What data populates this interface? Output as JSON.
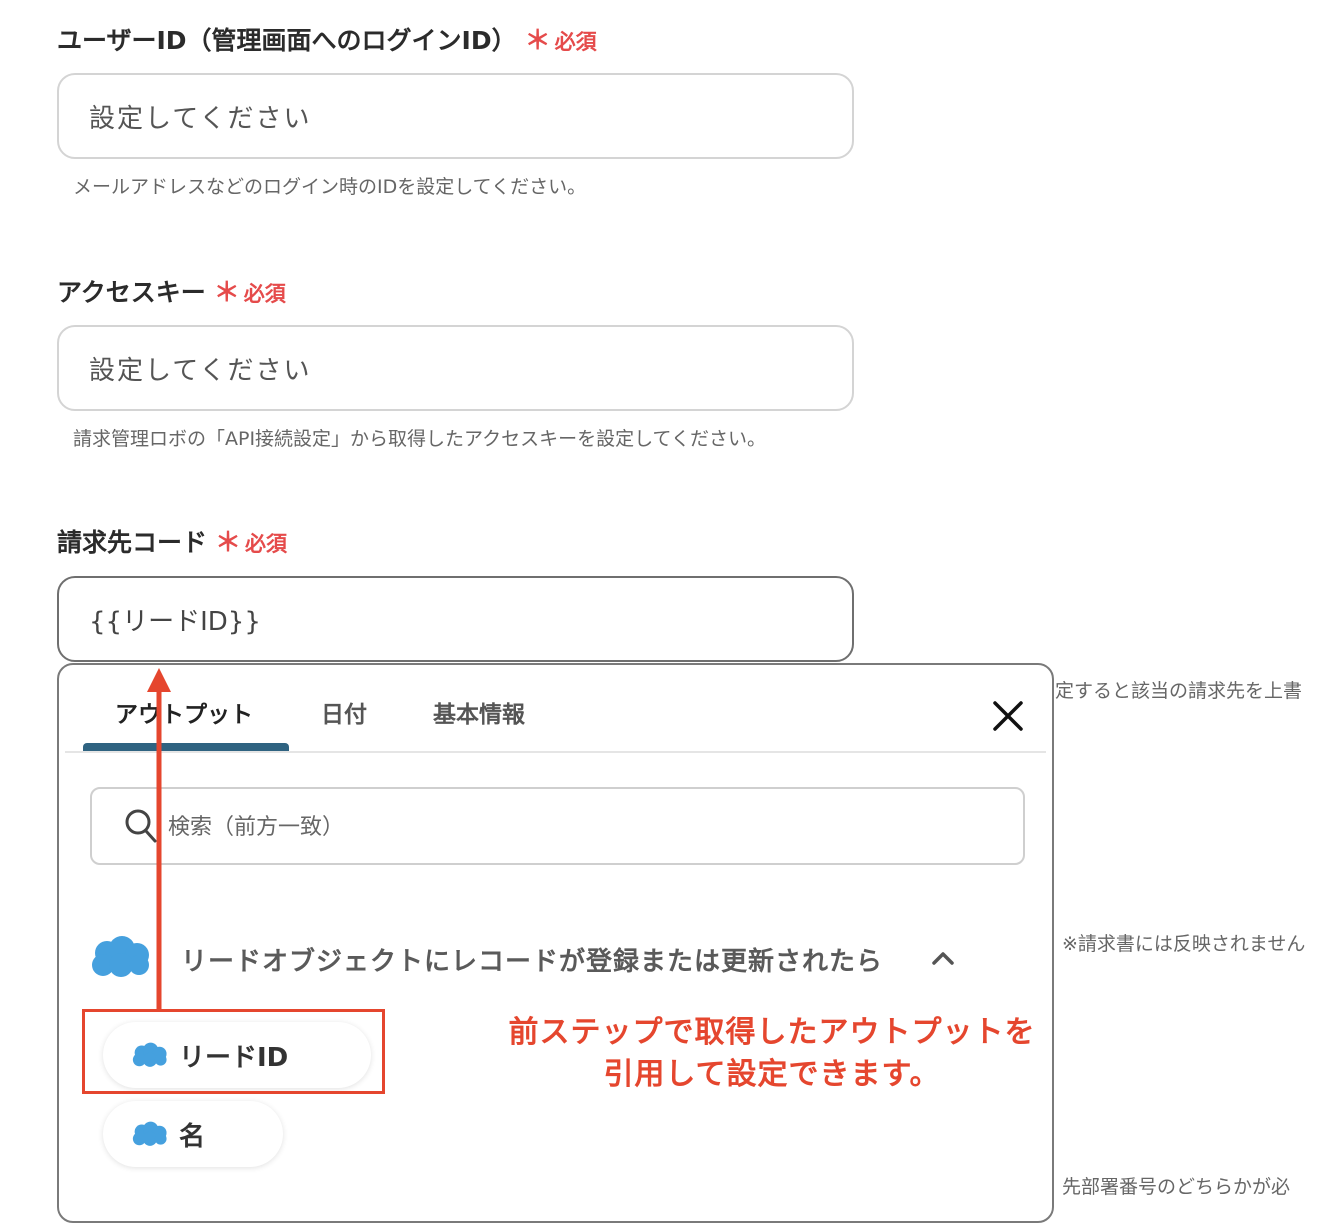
{
  "fields": [
    {
      "label": "ユーザーID（管理画面へのログインID）",
      "required_mark": "＊",
      "required_text": "必須",
      "value": "設定してください",
      "help": "メールアドレスなどのログイン時のIDを設定してください。"
    },
    {
      "label": "アクセスキー",
      "required_mark": "＊",
      "required_text": "必須",
      "value": "設定してください",
      "help": "請求管理ロボの「API接続設定」から取得したアクセスキーを設定してください。"
    },
    {
      "label": "請求先コード",
      "required_mark": "＊",
      "required_text": "必須",
      "value": "{{リードID}}"
    }
  ],
  "side_texts": [
    "定すると該当の請求先を上書",
    "※請求書には反映されません",
    "先部署番号のどちらかが必"
  ],
  "popup": {
    "tabs": [
      "アウトプット",
      "日付",
      "基本情報"
    ],
    "active_tab": 0,
    "search_placeholder": "検索（前方一致）",
    "group_title": "リードオブジェクトにレコードが登録または更新されたら",
    "items": [
      "リードID",
      "名"
    ]
  },
  "annotation": {
    "line1": "前ステップで取得したアウトプットを",
    "line2": "引用して設定できます。"
  },
  "colors": {
    "required": "#e54b4b",
    "annotation": "#e5462e",
    "tab_underline": "#2f6381",
    "salesforce": "#45a0de"
  },
  "icons": [
    "salesforce-cloud-icon",
    "search-icon",
    "close-icon",
    "chevron-up-icon",
    "arrow-up-icon"
  ]
}
